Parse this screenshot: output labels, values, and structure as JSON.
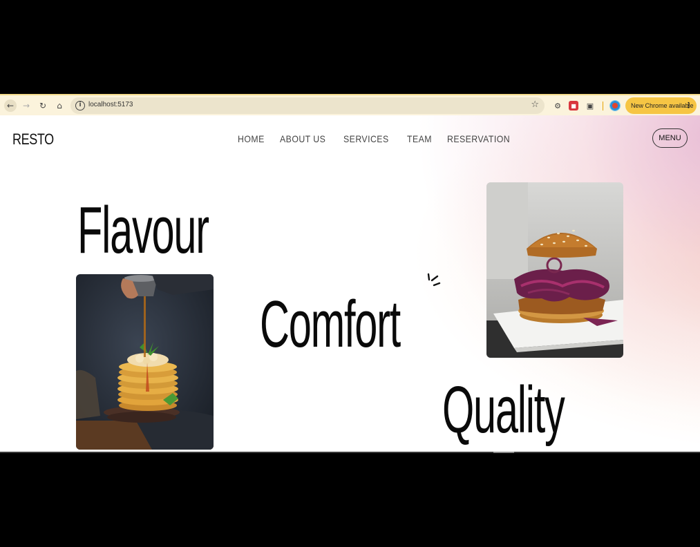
{
  "browser": {
    "url": "localhost:5173",
    "update_label": "New Chrome available",
    "icons": [
      "back-arrow-icon",
      "forward-arrow-icon",
      "reload-icon",
      "home-icon",
      "site-info-icon",
      "bookmark-star-icon",
      "extension-icon",
      "puzzle-extensions-icon",
      "profile-avatar-icon",
      "kebab-menu-icon"
    ]
  },
  "header": {
    "logo": "RESTO",
    "nav": [
      "HOME",
      "ABOUT US",
      "SERVICES",
      "TEAM",
      "RESERVATION"
    ],
    "menu_label": "MENU"
  },
  "hero": {
    "words": [
      "Flavour",
      "Comfort",
      "Quality"
    ]
  },
  "colors": {
    "text": "#0a0a0a",
    "glow_pink": "#e1aacd",
    "glow_peach": "#f6bea0",
    "chrome_bar": "#fbf3dc",
    "update_pill": "#f6c544"
  }
}
